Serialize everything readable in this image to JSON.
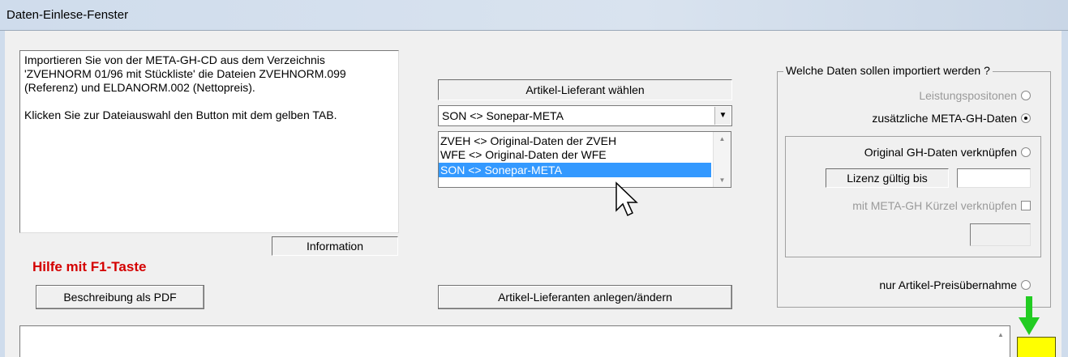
{
  "window": {
    "title": "Daten-Einlese-Fenster"
  },
  "info": {
    "paragraph1": "Importieren Sie von der META-GH-CD aus dem Verzeichnis 'ZVEHNORM 01/96 mit Stückliste' die Dateien ZVEHNORM.099 (Referenz) und ELDANORM.002 (Nettopreis).",
    "paragraph2": "Klicken Sie zur Dateiauswahl den Button mit dem gelben TAB.",
    "label": "Information"
  },
  "help": {
    "text": "Hilfe mit F1-Taste",
    "pdf_button": "Beschreibung als PDF"
  },
  "supplier": {
    "header": "Artikel-Lieferant wählen",
    "selected": "SON <> Sonepar-META",
    "options": [
      "ZVEH <> Original-Daten der ZVEH",
      "WFE <> Original-Daten der WFE",
      "SON <> Sonepar-META"
    ],
    "selected_index": 2,
    "manage_button": "Artikel-Lieferanten anlegen/ändern"
  },
  "import_group": {
    "caption": "Welche Daten sollen importiert werden ?",
    "option_leistung": "Leistungspositonen",
    "option_meta": "zusätzliche META-GH-Daten",
    "option_original": "Original GH-Daten verknüpfen",
    "license_label": "Lizenz gültig bis",
    "license_value": "",
    "kuerzel_label": "mit META-GH Kürzel verknüpfen",
    "option_preis": "nur Artikel-Preisübernahme"
  },
  "colors": {
    "help_red": "#d40000",
    "selection_blue": "#3399ff",
    "tab_yellow": "#ffff00",
    "arrow_green": "#22cc22"
  }
}
